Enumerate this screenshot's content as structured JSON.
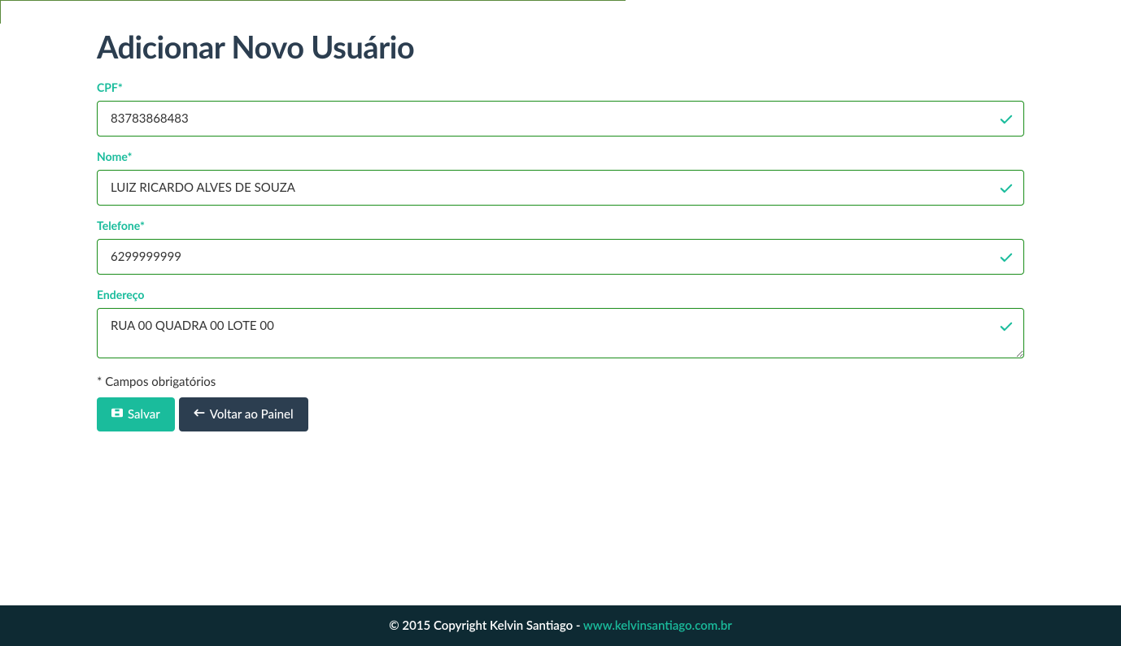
{
  "page": {
    "title": "Adicionar Novo Usuário"
  },
  "form": {
    "cpf": {
      "label": "CPF*",
      "value": "83783868483"
    },
    "nome": {
      "label": "Nome*",
      "value": "LUIZ RICARDO ALVES DE SOUZA"
    },
    "telefone": {
      "label": "Telefone*",
      "value": "6299999999"
    },
    "endereco": {
      "label": "Endereço",
      "value": "RUA 00 QUADRA 00 LOTE 00"
    },
    "required_note": "* Campos obrigatórios",
    "save_label": "Salvar",
    "back_label": "Voltar ao Painel"
  },
  "footer": {
    "copyright": "© 2015 Copyright Kelvin Santiago - ",
    "link_text": "www.kelvinsantiago.com.br"
  }
}
